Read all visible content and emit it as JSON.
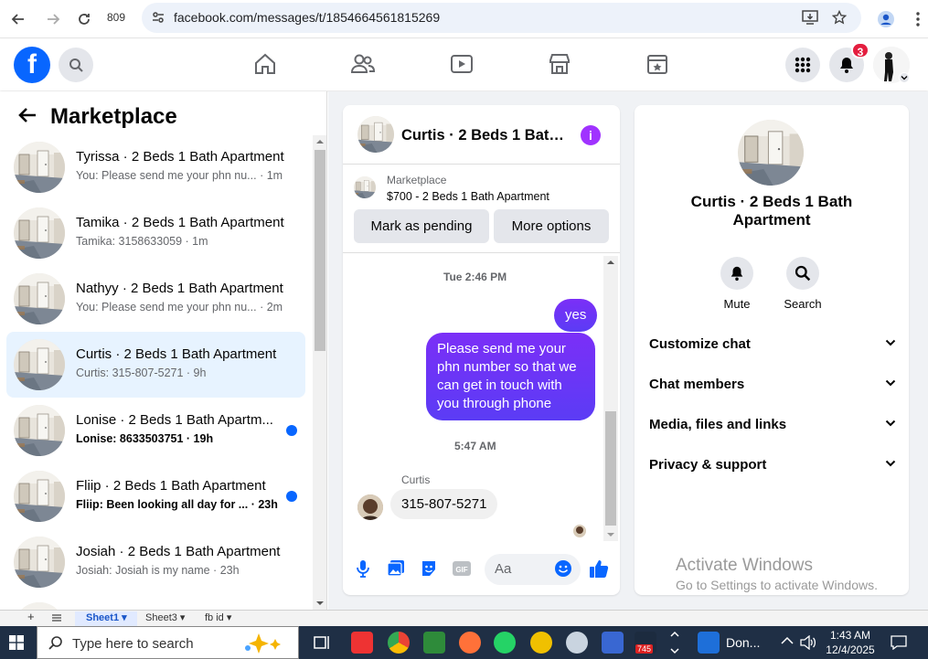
{
  "browser": {
    "tab_count": "809",
    "url": "facebook.com/messages/t/1854664561815269"
  },
  "header": {
    "logo_letter": "f",
    "notification_count": "3"
  },
  "sidebar": {
    "title": "Marketplace",
    "conversations": [
      {
        "name": "Tyrissa · 2 Beds 1 Bath Apartment",
        "preview": "You: Please send me your phn nu...",
        "time": "· 1m",
        "unread": false
      },
      {
        "name": "Tamika · 2 Beds 1 Bath Apartment",
        "preview": "Tamika: 3158633059 · 1m",
        "time": "",
        "unread": false
      },
      {
        "name": "Nathyy · 2 Beds 1 Bath Apartment",
        "preview": "You: Please send me your phn nu...",
        "time": "· 2m",
        "unread": false
      },
      {
        "name": "Curtis · 2 Beds 1 Bath Apartment",
        "preview": "Curtis: 315-807-5271 · 9h",
        "time": "",
        "unread": false
      },
      {
        "name": "Lonise · 2 Beds 1 Bath Apartm...",
        "preview": "Lonise: 8633503751 · 19h",
        "time": "",
        "unread": true
      },
      {
        "name": "Fliip · 2 Beds 1 Bath Apartment",
        "preview": "Fliip: Been looking all day for ...",
        "time": "· 23h",
        "unread": true
      },
      {
        "name": "Josiah · 2 Beds 1 Bath Apartment",
        "preview": "Josiah: Josiah is my name · 23h",
        "time": "",
        "unread": false
      }
    ]
  },
  "chat": {
    "title": "Curtis · 2 Beds 1 Bath...",
    "marketplace_label": "Marketplace",
    "listing": "$700 - 2 Beds 1 Bath Apartment",
    "btn_pending": "Mark as pending",
    "btn_more": "More options",
    "time1": "Tue 2:46 PM",
    "msg_yes": "yes",
    "msg_long": "Please send me your phn number so that we can get in touch with you through phone",
    "time2": "5:47 AM",
    "sender": "Curtis",
    "msg_in": "315-807-5271",
    "composer_placeholder": "Aa"
  },
  "details": {
    "title": "Curtis · 2 Beds 1 Bath Apartment",
    "mute": "Mute",
    "search": "Search",
    "rows": [
      "Customize chat",
      "Chat members",
      "Media, files and links",
      "Privacy & support"
    ],
    "watermark1": "Activate Windows",
    "watermark2": "Go to Settings to activate Windows."
  },
  "sheets": {
    "s1": "Sheet1",
    "s2": "Sheet3",
    "s3": "fb id"
  },
  "taskbar": {
    "search_placeholder": "Type here to search",
    "app_label": "Don...",
    "time": "1:43 AM",
    "date": "12/4/2025",
    "badge": "745"
  },
  "colors": {
    "fb_blue": "#0866ff",
    "messenger_purple": "#7b2ff7"
  }
}
